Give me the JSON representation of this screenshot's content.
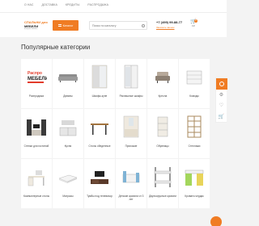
{
  "topnav": {
    "links": [
      "О нас",
      "Доставка",
      "Кредиты",
      "Распродажа"
    ]
  },
  "header": {
    "logo_line1": "СПАЛЬНИ для",
    "logo_line2": "МЕБЕЛИ",
    "logo_line3": "интернет магазин",
    "catalog_label": "Каталог",
    "search_placeholder": "Поиск по каталогу",
    "phone": "+7 (499) 99-88-77",
    "callback": "Заказать звонок",
    "cart_count": "0",
    "cart_label": "0 ₽"
  },
  "page_title": "Популярные категории",
  "categories": [
    {
      "label": "Распродажа",
      "icon": "sale-banner-icon"
    },
    {
      "label": "Диваны",
      "icon": "sofa-icon"
    },
    {
      "label": "Шкафы-купе",
      "icon": "wardrobe-icon"
    },
    {
      "label": "Распашные шкафы",
      "icon": "cabinet-icon"
    },
    {
      "label": "Кресла",
      "icon": "armchair-icon"
    },
    {
      "label": "Комоды",
      "icon": "dresser-icon"
    },
    {
      "label": "Стенки для гостиной",
      "icon": "wall-unit-icon"
    },
    {
      "label": "Кухни",
      "icon": "kitchen-icon"
    },
    {
      "label": "Столы обеденные",
      "icon": "dining-table-icon"
    },
    {
      "label": "Прихожие",
      "icon": "hallway-icon"
    },
    {
      "label": "Обувницы",
      "icon": "shoe-rack-icon"
    },
    {
      "label": "Стеллажи",
      "icon": "shelving-icon"
    },
    {
      "label": "Компьютерные столы",
      "icon": "computer-desk-icon"
    },
    {
      "label": "Матрасы",
      "icon": "mattress-icon"
    },
    {
      "label": "Тумбы под телевизор",
      "icon": "tv-stand-icon"
    },
    {
      "label": "Детские кровати от 3 лет",
      "icon": "kids-bed-icon"
    },
    {
      "label": "Двухъярусные кровати",
      "icon": "bunk-bed-icon"
    },
    {
      "label": "Кровати-чердак",
      "icon": "loft-bed-icon"
    }
  ],
  "sidebar": {
    "icons": [
      "compare-icon",
      "heart-icon",
      "cart-icon"
    ]
  },
  "colors": {
    "accent": "#f07c23",
    "card_bg": "#ffffff",
    "page_bg": "#f3f3f3"
  }
}
